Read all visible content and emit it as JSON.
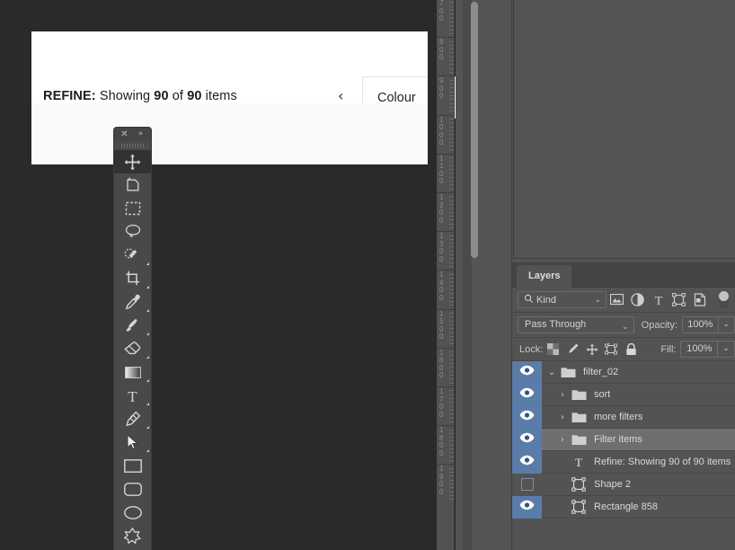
{
  "app": {
    "background_color": "#2b2a29",
    "panel_color": "#535353"
  },
  "canvas": {
    "artboard": {
      "refine_prefix": "REFINE:",
      "refine_showing": " Showing ",
      "refine_count_shown": "90",
      "refine_of": " of ",
      "refine_count_total": "90",
      "refine_suffix": " items",
      "prev_chevron": "‹",
      "colour_button_label": "Colour"
    },
    "ruler": {
      "unit_hint": "px",
      "labels": [
        "700",
        "800",
        "900",
        "1000",
        "1100",
        "1200",
        "1300",
        "1400",
        "1500",
        "1600",
        "1700",
        "1800",
        "1900"
      ]
    }
  },
  "tools_panel": {
    "close_glyph": "✕",
    "expand_glyph": "»",
    "tools": [
      {
        "name": "move-tool",
        "icon": "move",
        "active": true,
        "has_submenu": false
      },
      {
        "name": "artboard-tool",
        "icon": "artboard",
        "active": false,
        "has_submenu": false
      },
      {
        "name": "rectangular-marquee-tool",
        "icon": "marquee",
        "active": false,
        "has_submenu": false
      },
      {
        "name": "lasso-tool",
        "icon": "lasso",
        "active": false,
        "has_submenu": false
      },
      {
        "name": "quick-selection-tool",
        "icon": "quick-select",
        "active": false,
        "has_submenu": true
      },
      {
        "name": "crop-tool",
        "icon": "crop",
        "active": false,
        "has_submenu": true
      },
      {
        "name": "eyedropper-tool",
        "icon": "eyedropper",
        "active": false,
        "has_submenu": true
      },
      {
        "name": "brush-tool",
        "icon": "brush",
        "active": false,
        "has_submenu": true
      },
      {
        "name": "eraser-tool",
        "icon": "eraser",
        "active": false,
        "has_submenu": true
      },
      {
        "name": "gradient-tool",
        "icon": "gradient",
        "active": false,
        "has_submenu": true
      },
      {
        "name": "type-tool",
        "icon": "type",
        "active": false,
        "has_submenu": true
      },
      {
        "name": "pen-tool",
        "icon": "pen",
        "active": false,
        "has_submenu": true
      },
      {
        "name": "path-selection-tool",
        "icon": "path-select",
        "active": false,
        "has_submenu": true
      },
      {
        "name": "rectangle-tool",
        "icon": "rectangle",
        "active": false,
        "has_submenu": false
      },
      {
        "name": "rounded-rectangle-tool",
        "icon": "rounded-rect",
        "active": false,
        "has_submenu": false
      },
      {
        "name": "ellipse-tool",
        "icon": "ellipse",
        "active": false,
        "has_submenu": false
      },
      {
        "name": "custom-shape-tool",
        "icon": "custom-shape",
        "active": false,
        "has_submenu": false
      }
    ]
  },
  "layers_panel": {
    "tab_label": "Layers",
    "filter": {
      "kind_label": "Kind",
      "caret": "⌄",
      "icons": [
        "pixel-layer-filter-icon",
        "adjustment-layer-filter-icon",
        "type-layer-filter-icon",
        "shape-layer-filter-icon",
        "smart-object-filter-icon"
      ],
      "toggle_name": "filter-enable-toggle"
    },
    "blend": {
      "mode": "Pass Through",
      "caret": "⌄",
      "opacity_label": "Opacity:",
      "opacity_value": "100%"
    },
    "lock": {
      "label": "Lock:",
      "icons": [
        "lock-transparent-pixels-icon",
        "lock-image-pixels-icon",
        "lock-position-icon",
        "lock-artboard-nesting-icon",
        "lock-all-icon"
      ],
      "fill_label": "Fill:",
      "fill_value": "100%"
    },
    "layers": [
      {
        "name": "filter_02",
        "type": "group",
        "visible": true,
        "selected": false,
        "indent": 0,
        "expanded": true,
        "disclosure": "⌄"
      },
      {
        "name": "sort",
        "type": "group",
        "visible": true,
        "selected": false,
        "indent": 1,
        "expanded": false,
        "disclosure": "›"
      },
      {
        "name": "more filters",
        "type": "group",
        "visible": true,
        "selected": false,
        "indent": 1,
        "expanded": false,
        "disclosure": "›"
      },
      {
        "name": "Filter items",
        "type": "group",
        "visible": true,
        "selected": true,
        "indent": 1,
        "expanded": false,
        "disclosure": "›"
      },
      {
        "name": "Refine: Showing 90 of 90 items",
        "type": "type",
        "visible": true,
        "selected": false,
        "indent": 1,
        "expanded": false,
        "disclosure": ""
      },
      {
        "name": "Shape 2",
        "type": "shape",
        "visible": false,
        "selected": false,
        "indent": 1,
        "expanded": false,
        "disclosure": ""
      },
      {
        "name": "Rectangle 858",
        "type": "shape",
        "visible": true,
        "selected": false,
        "indent": 1,
        "expanded": false,
        "disclosure": ""
      }
    ]
  }
}
